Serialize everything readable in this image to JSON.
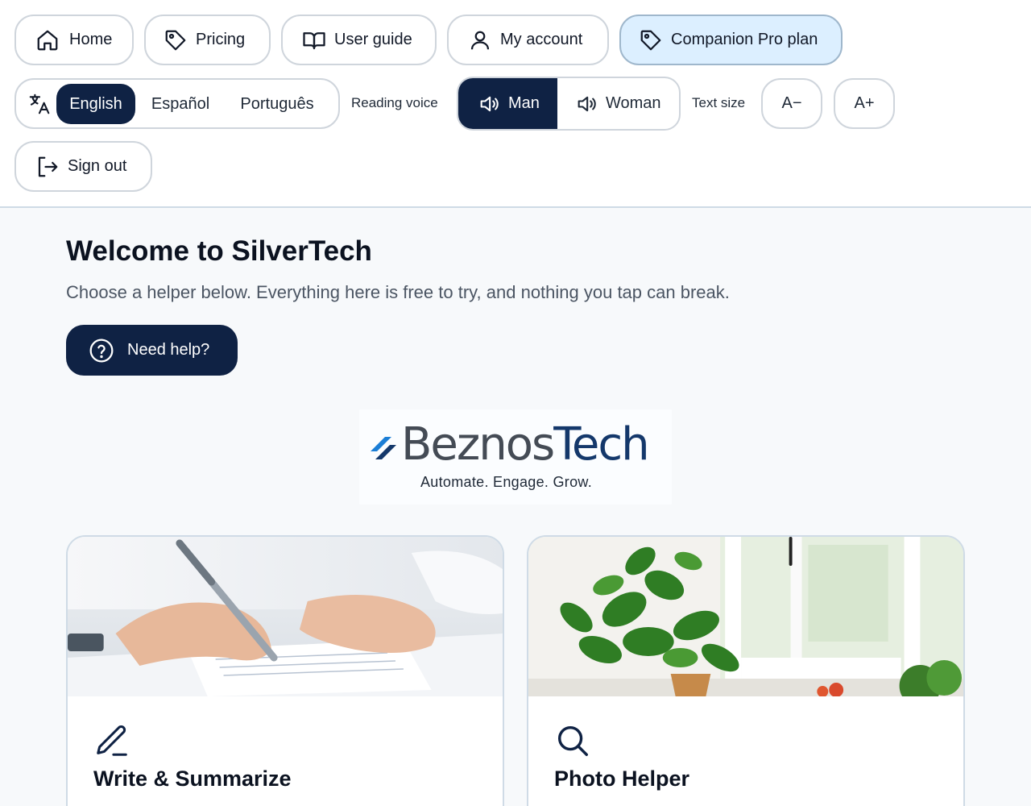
{
  "nav": {
    "home": "Home",
    "pricing": "Pricing",
    "user_guide": "User guide",
    "my_account": "My account",
    "pro_plan": "Companion Pro plan",
    "sign_out": "Sign out"
  },
  "language": {
    "options": [
      "English",
      "Español",
      "Português"
    ],
    "selected": "English"
  },
  "voice": {
    "label": "Reading voice",
    "options": [
      "Man",
      "Woman"
    ],
    "selected": "Man"
  },
  "text_size": {
    "label": "Text size",
    "decrease": "A−",
    "increase": "A+"
  },
  "main": {
    "title": "Welcome to SilverTech",
    "subtitle": "Choose a helper below. Everything here is free to try, and nothing you tap can break.",
    "help_button": "Need help?"
  },
  "logo": {
    "word_part1": "Beznos",
    "word_part2": "Tech",
    "tagline": "Automate. Engage. Grow."
  },
  "cards": [
    {
      "title": "Write & Summarize",
      "icon": "pencil-icon"
    },
    {
      "title": "Photo Helper",
      "icon": "magnifier-icon"
    }
  ],
  "colors": {
    "primary": "#0f2244",
    "pro_bg": "#dcefff",
    "logo_blue": "#14386b",
    "logo_gray": "#444b55"
  }
}
